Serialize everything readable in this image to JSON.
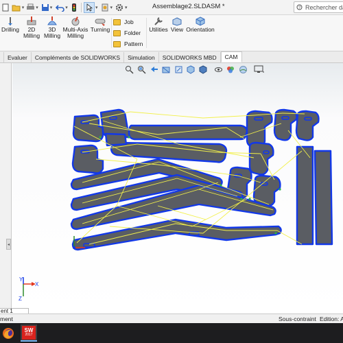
{
  "title_bar": {
    "document_title": "Assemblage2.SLDASM *",
    "search_placeholder": "Rechercher dans",
    "quick_access": [
      "new-icon",
      "open-icon",
      "print-icon",
      "save-icon",
      "undo-icon",
      "rebuild-icon",
      "select-icon",
      "options-icon"
    ]
  },
  "ribbon": {
    "buttons": [
      {
        "label": "Drilling"
      },
      {
        "label": "2D\nMilling"
      },
      {
        "label": "3D\nMilling"
      },
      {
        "label": "Multi-Axis\nMilling"
      },
      {
        "label": "Turning"
      }
    ],
    "list_items": [
      {
        "label": "Job",
        "icon": "job-icon"
      },
      {
        "label": "Folder",
        "icon": "folder-icon"
      },
      {
        "label": "Pattern",
        "icon": "pattern-icon"
      }
    ],
    "right_buttons": [
      {
        "label": "Utilities"
      },
      {
        "label": "View"
      },
      {
        "label": "Orientation"
      }
    ]
  },
  "tabs": [
    {
      "label": "",
      "active": false
    },
    {
      "label": "Evaluer",
      "active": false
    },
    {
      "label": "Compléments de SOLIDWORKS",
      "active": false
    },
    {
      "label": "Simulation",
      "active": false
    },
    {
      "label": "SOLIDWORKS MBD",
      "active": false
    },
    {
      "label": "CAM",
      "active": true
    }
  ],
  "status_bar": {
    "sheet_tab": "ent 1",
    "left_text": "ment",
    "constraint": "Sous-contraint",
    "edit_mode": "Edition: A"
  },
  "taskbar": {
    "sw_badge_top": "SW",
    "sw_badge_year": "2017"
  },
  "colors": {
    "part_fill": "#5a5d63",
    "outline": "#1238e8",
    "toolpath": "#f2f04a",
    "accent": "#d9261c"
  },
  "axis": {
    "x": "X",
    "y": "Y",
    "z": "Z"
  }
}
